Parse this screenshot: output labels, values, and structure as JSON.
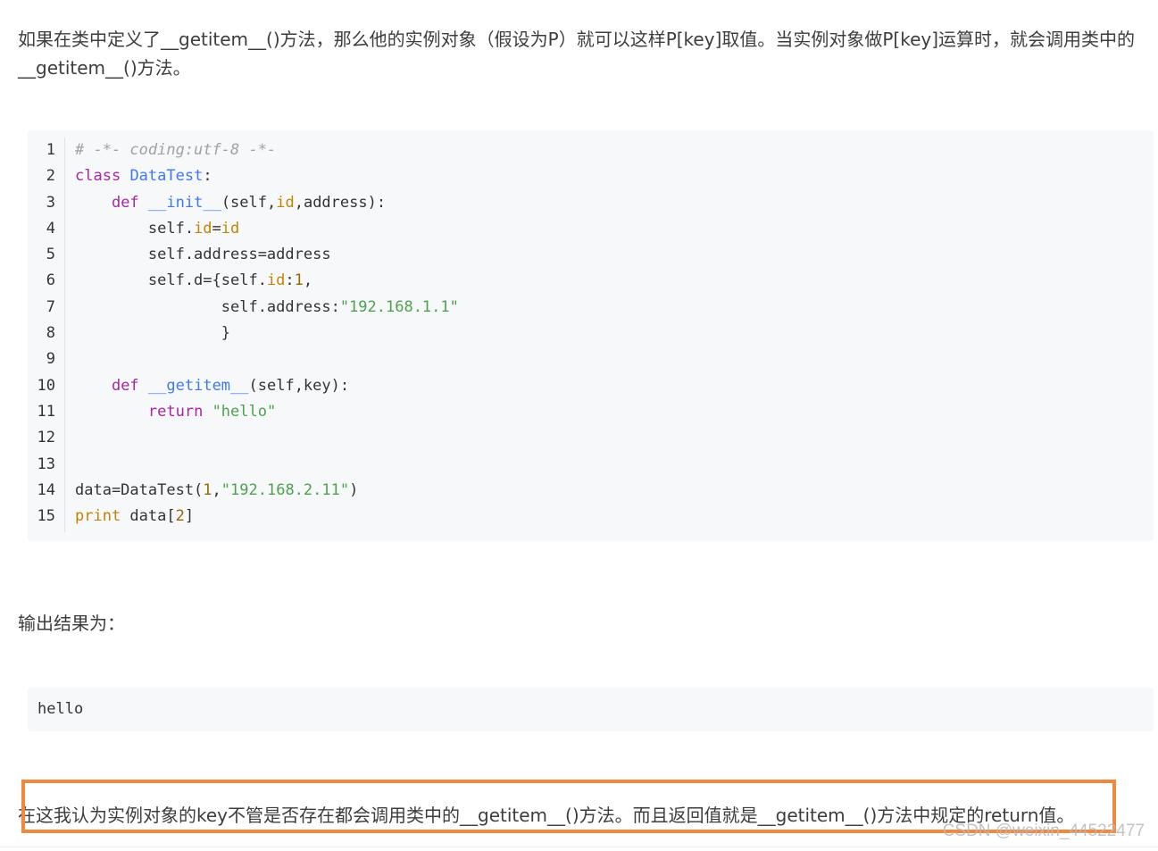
{
  "intro": {
    "text": "如果在类中定义了__getitem__()方法，那么他的实例对象（假设为P）就可以这样P[key]取值。当实例对象做P[key]运算时，就会调用类中的__getitem__()方法。"
  },
  "code": {
    "line_numbers": [
      "1",
      "2",
      "3",
      "4",
      "5",
      "6",
      "7",
      "8",
      "9",
      "10",
      "11",
      "12",
      "13",
      "14",
      "15"
    ],
    "l1_comment": "# -*- coding:utf-8 -*-",
    "l2_kw": "class",
    "l2_name": "DataTest",
    "l2_rest": ":",
    "l3_indent": "    ",
    "l3_kw": "def",
    "l3_fn": "__init__",
    "l3_a": "(self,",
    "l3_id": "id",
    "l3_b": ",address):",
    "l4_a": "        self.",
    "l4_id": "id",
    "l4_eq": "=",
    "l4_id2": "id",
    "l5_text": "        self.address=address",
    "l6_a": "        self.d={self.",
    "l6_id": "id",
    "l6_colon": ":",
    "l6_num": "1",
    "l6_comma": ",",
    "l7_a": "                self.address:",
    "l7_str": "\"192.168.1.1\"",
    "l8_text": "                }",
    "l9_text": "",
    "l10_indent": "    ",
    "l10_kw": "def",
    "l10_fn": "__getitem__",
    "l10_rest": "(self,key):",
    "l11_indent": "        ",
    "l11_kw": "return",
    "l11_str": "\"hello\"",
    "l12_text": "",
    "l13_text": "",
    "l14_a": "data=DataTest(",
    "l14_num": "1",
    "l14_comma": ",",
    "l14_str": "\"192.168.2.11\"",
    "l14_close": ")",
    "l15_kw": "print",
    "l15_a": " data[",
    "l15_num": "2",
    "l15_close": "]"
  },
  "output_label": {
    "text": "输出结果为："
  },
  "output": {
    "text": "hello"
  },
  "conclusion": {
    "text": "在这我认为实例对象的key不管是否存在都会调用类中的__getitem__()方法。而且返回值就是__getitem__()方法中规定的return值。"
  },
  "watermark": {
    "text": "CSDN @weixin_44522477"
  },
  "colors": {
    "highlight_border": "#f0883e",
    "code_background": "#f6f8fa",
    "keyword": "#a626a4",
    "string": "#50a14f",
    "function_name": "#4078f2",
    "number": "#986801",
    "comment": "#a0a1a7"
  }
}
